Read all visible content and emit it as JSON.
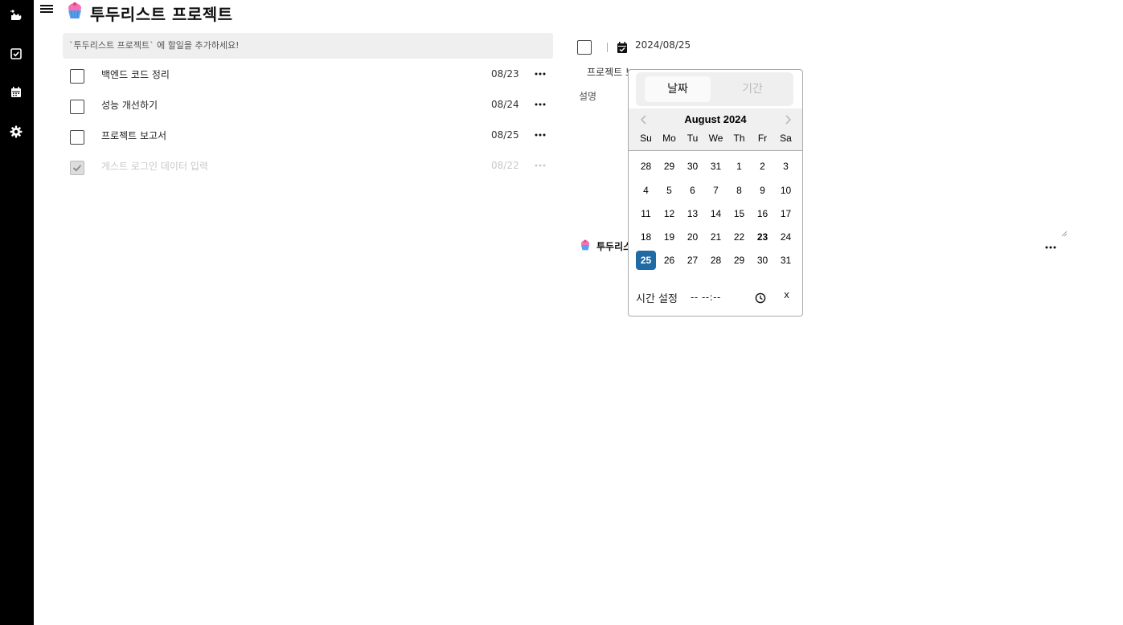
{
  "sidebar": {
    "icons": [
      "hen-logo-icon",
      "checkbox-icon",
      "calendar-icon",
      "gear-icon"
    ]
  },
  "header": {
    "menu_icon": "hamburger-icon",
    "project_emoji": "cupcake-icon",
    "title": "투두리스트 프로젝트"
  },
  "add_input": {
    "placeholder": "`투두리스트 프로젝트` 에 할일을 추가하세요!"
  },
  "todos": [
    {
      "title": "백엔드 코드 정리",
      "date": "08/23",
      "done": false
    },
    {
      "title": "성능 개선하기",
      "date": "08/24",
      "done": false
    },
    {
      "title": "프로젝트 보고서",
      "date": "08/25",
      "done": false
    },
    {
      "title": "게스트 로그인 데이터 입력",
      "date": "08/22",
      "done": true
    }
  ],
  "detail": {
    "date": "2024/08/25",
    "title": "프로젝트 보고서",
    "description_label": "설명",
    "project_name": "투두리스트 프로젝트"
  },
  "datepicker": {
    "tabs": {
      "date": "날짜",
      "range": "기간"
    },
    "month_label": "August 2024",
    "weekdays": [
      "Su",
      "Mo",
      "Tu",
      "We",
      "Th",
      "Fr",
      "Sa"
    ],
    "weeks": [
      [
        "28",
        "29",
        "30",
        "31",
        "1",
        "2",
        "3"
      ],
      [
        "4",
        "5",
        "6",
        "7",
        "8",
        "9",
        "10"
      ],
      [
        "11",
        "12",
        "13",
        "14",
        "15",
        "16",
        "17"
      ],
      [
        "18",
        "19",
        "20",
        "21",
        "22",
        "23",
        "24"
      ],
      [
        "25",
        "26",
        "27",
        "28",
        "29",
        "30",
        "31"
      ]
    ],
    "today": "23",
    "selected": "25",
    "time_label": "시간 설정",
    "time_value": "-- --:--",
    "close_label": "x",
    "accent_color": "#216ba5"
  }
}
